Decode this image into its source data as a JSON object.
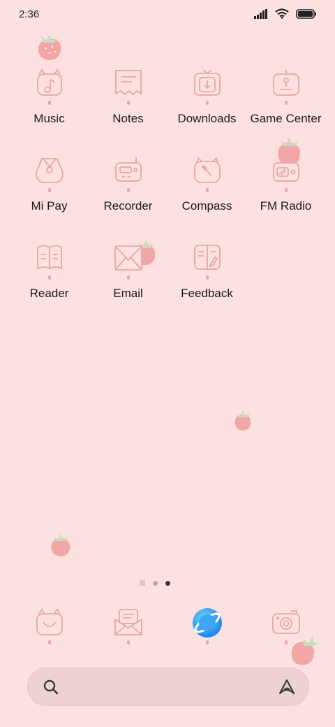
{
  "status_bar": {
    "time": "2:36"
  },
  "apps": [
    {
      "label": "Music",
      "icon": "music-icon"
    },
    {
      "label": "Notes",
      "icon": "notes-icon"
    },
    {
      "label": "Downloads",
      "icon": "downloads-icon"
    },
    {
      "label": "Game Center",
      "icon": "game-center-icon"
    },
    {
      "label": "Mi Pay",
      "icon": "mi-pay-icon"
    },
    {
      "label": "Recorder",
      "icon": "recorder-icon"
    },
    {
      "label": "Compass",
      "icon": "compass-icon"
    },
    {
      "label": "FM Radio",
      "icon": "fm-radio-icon"
    },
    {
      "label": "Reader",
      "icon": "reader-icon"
    },
    {
      "label": "Email",
      "icon": "email-icon"
    },
    {
      "label": "Feedback",
      "icon": "feedback-icon"
    }
  ],
  "dock": [
    {
      "icon": "phone-icon"
    },
    {
      "icon": "messages-icon"
    },
    {
      "icon": "browser-icon"
    },
    {
      "icon": "camera-icon"
    }
  ],
  "page_indicator": {
    "pages": 2,
    "active": 2
  },
  "colors": {
    "background": "#fde1e1",
    "icon_line": "#e7a5a5",
    "strawberry": "#f2a9a9",
    "leaf": "#bfd8bf"
  }
}
